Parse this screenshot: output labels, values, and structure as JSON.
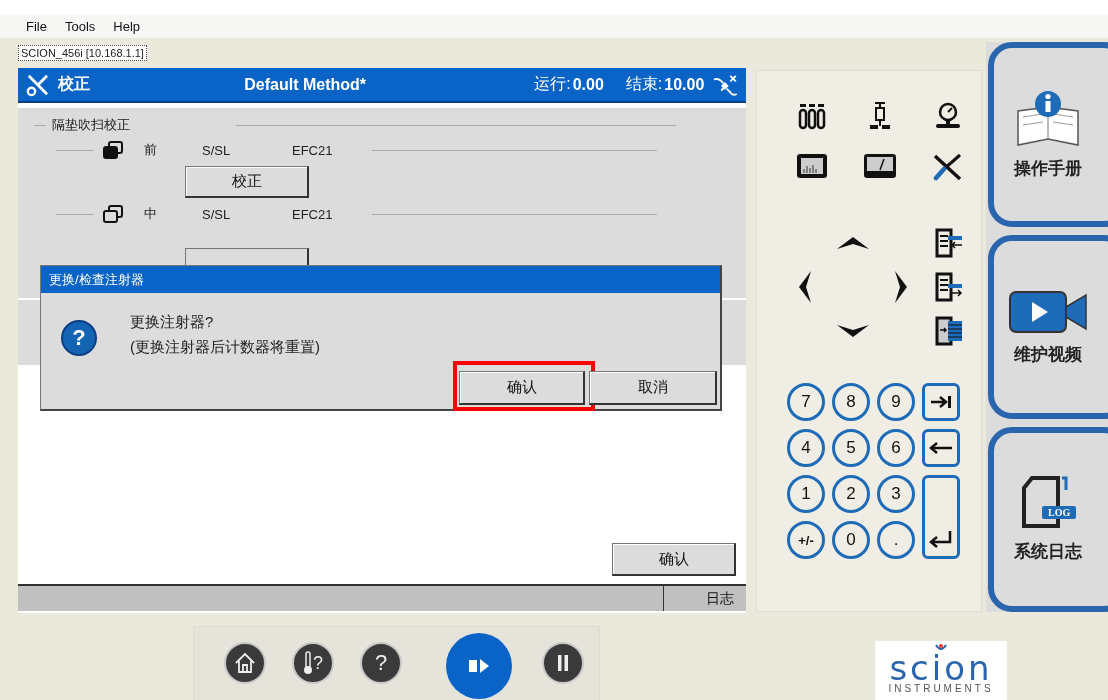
{
  "menu": [
    "File",
    "Tools",
    "Help"
  ],
  "connection_tab": {
    "label": "SCION_456i [10.168.1.1]",
    "selected": true
  },
  "panel": {
    "title": "校正",
    "method": "Default Method*",
    "run_label": "运行:",
    "run_value": "0.00",
    "end_label": "结束:",
    "end_value": "10.00"
  },
  "group": {
    "title": "隔垫吹扫校正",
    "rows": [
      {
        "kind": "filled",
        "position": "前",
        "inlet": "S/SL",
        "controller": "EFC21",
        "button": "校正"
      },
      {
        "kind": "outline",
        "position": "中",
        "inlet": "S/SL",
        "controller": "EFC21"
      }
    ]
  },
  "confirm_button": "确认",
  "status_bar": {
    "log": "日志"
  },
  "dialog": {
    "title": "更换/检查注射器",
    "icon_mark": "?",
    "message": "更换注射器?",
    "detail": "(更换注射器后计数器将重置)",
    "buttons": [
      {
        "label": "确认",
        "highlighted": true
      },
      {
        "label": "取消",
        "highlighted": false
      }
    ]
  },
  "keypad": {
    "digits": [
      "7",
      "8",
      "9",
      "4",
      "5",
      "6",
      "1",
      "2",
      "3",
      "+/-",
      "0",
      "."
    ],
    "icon_keys": [
      {
        "kind": "tab"
      },
      {
        "kind": "backspace"
      },
      {
        "kind": "enter"
      }
    ]
  },
  "side_buttons": [
    {
      "kind": "manual",
      "label": "操作手册"
    },
    {
      "kind": "video",
      "label": "维护视频"
    },
    {
      "kind": "log",
      "label": "系统日志",
      "badge": "LOG"
    }
  ],
  "toolbar": {
    "thermo_mark": "?",
    "help_mark": "?"
  },
  "logo": {
    "name": "scion",
    "subtitle": "INSTRUMENTS"
  }
}
